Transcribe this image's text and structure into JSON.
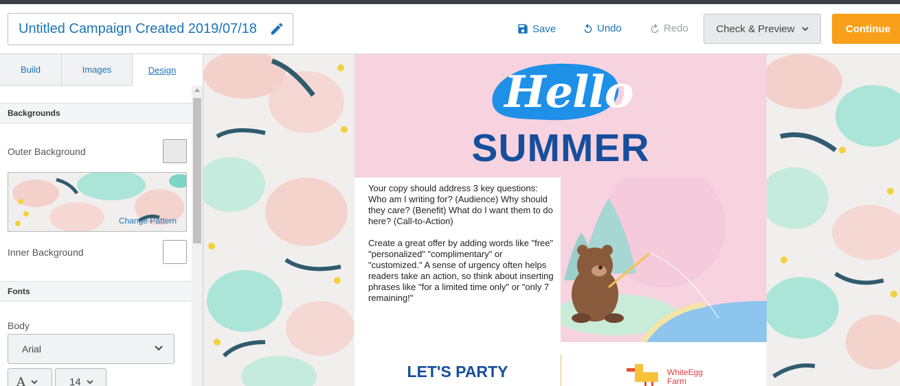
{
  "header": {
    "campaign_title": "Untitled Campaign Created 2019/07/18",
    "edit_icon": "pencil-icon",
    "save_label": "Save",
    "undo_label": "Undo",
    "redo_label": "Redo",
    "check_preview_label": "Check & Preview",
    "continue_label": "Continue"
  },
  "sidebar": {
    "tabs": [
      {
        "label": "Build"
      },
      {
        "label": "Images"
      },
      {
        "label": "Design"
      }
    ],
    "sections": {
      "backgrounds": "Backgrounds",
      "fonts": "Fonts"
    },
    "outer_background_label": "Outer Background",
    "change_pattern_label": "Change Pattern",
    "inner_background_label": "Inner Background",
    "body_label": "Body",
    "body_font": "Arial",
    "font_style_glyph": "A",
    "font_size": "14"
  },
  "email": {
    "hello": "Hello",
    "summer": "SUMMER",
    "copy_para1": "Your copy should address 3 key questions: Who am I writing for? (Audience) Why should they care? (Benefit) What do I want them to do here? (Call-to-Action)",
    "copy_para2": "Create a great offer by adding words like \"free\" \"personalized\" \"complimentary\" or \"customized.\" A sense of urgency often helps readers take an action, so think about inserting phrases like \"for a limited time only\" or \"only 7 remaining!\"",
    "lets_party": "LET'S PARTY",
    "logo_line1": "WhiteEgg",
    "logo_line2": "Farm"
  },
  "colors": {
    "accent_blue": "#1a74b8",
    "continue_orange": "#f9a01b",
    "hero_pink": "#f7d3e0",
    "summer_navy": "#164e9c",
    "hello_blob_blue": "#1e90e8"
  }
}
